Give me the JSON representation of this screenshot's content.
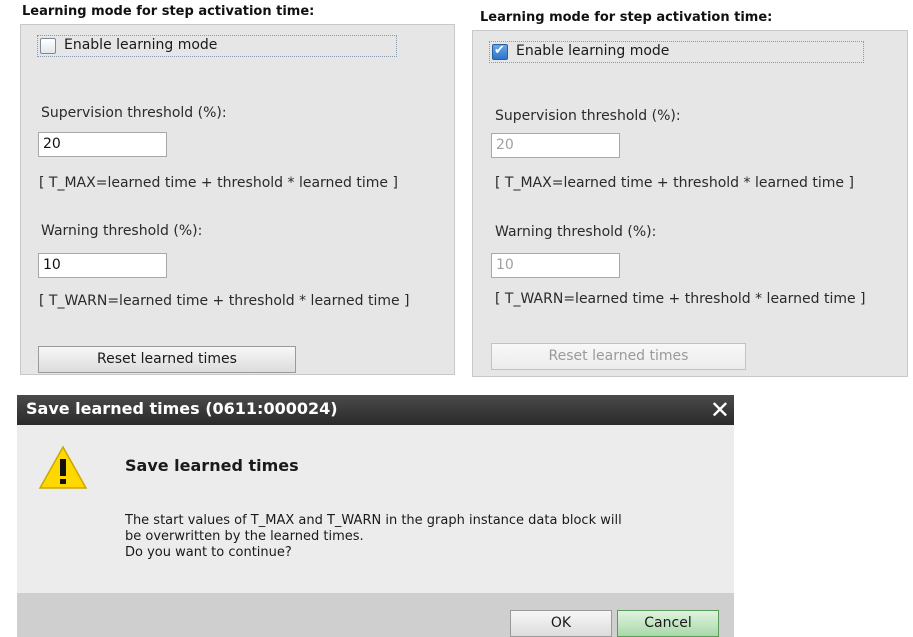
{
  "left_panel": {
    "title": "Learning mode for step activation time:",
    "checkbox_label": "Enable learning mode",
    "checkbox_checked": false,
    "supervision_label": "Supervision threshold (%):",
    "supervision_value": "20",
    "tmax_formula": "[ T_MAX=learned time + threshold * learned time ]",
    "warning_label": "Warning threshold (%):",
    "warning_value": "10",
    "twarn_formula": "[ T_WARN=learned time + threshold * learned time ]",
    "reset_button": "Reset learned times"
  },
  "right_panel": {
    "title": "Learning mode for step activation time:",
    "checkbox_label": "Enable learning mode",
    "checkbox_checked": true,
    "supervision_label": "Supervision threshold (%):",
    "supervision_value": "20",
    "tmax_formula": "[ T_MAX=learned time + threshold * learned time ]",
    "warning_label": "Warning threshold (%):",
    "warning_value": "10",
    "twarn_formula": "[ T_WARN=learned time + threshold * learned time ]",
    "reset_button": "Reset learned times"
  },
  "dialog": {
    "title": "Save learned times (0611:000024)",
    "close_symbol": "✕",
    "heading": "Save learned times",
    "message_line1": "The start values of T_MAX and T_WARN in the graph instance data block will",
    "message_line2": "be overwritten by the learned times.",
    "message_line3": "Do you want to continue?",
    "ok_button": "OK",
    "cancel_button": "Cancel"
  },
  "colors": {
    "panel_bg": "#e6e6e6",
    "dialog_titlebar": "#2a2a2a",
    "warning_yellow": "#ffd800",
    "focus_button": "#a9d9a9"
  }
}
